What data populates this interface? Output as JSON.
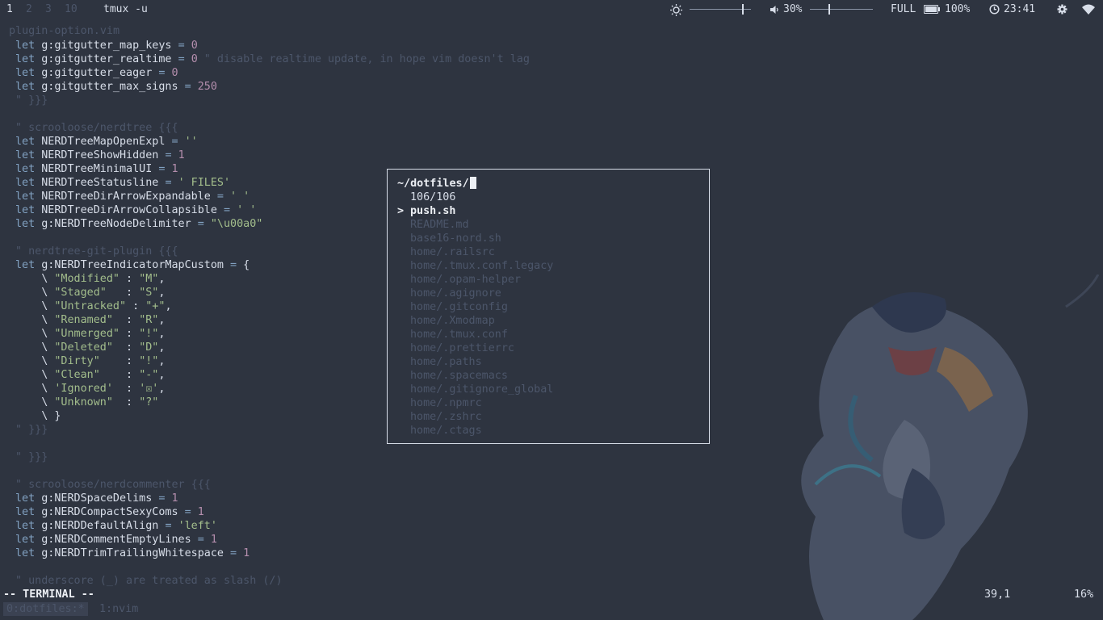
{
  "topbar": {
    "workspaces": [
      "1",
      "2",
      "3",
      "10"
    ],
    "active_workspace": "1",
    "window_title": "tmux -u",
    "brightness_icon": "sun-icon",
    "brightness_level": 0.85,
    "volume_icon": "speaker-icon",
    "volume_label": "30%",
    "volume_level": 0.3,
    "power_state": "FULL",
    "battery_icon": "battery-icon",
    "battery_label": "100%",
    "clock_icon": "clock-icon",
    "time": "23:41",
    "settings_icon": "gear-icon",
    "wifi_icon": "wifi-icon"
  },
  "editor": {
    "file_header": "plugin-option.vim",
    "lines": [
      {
        "parts": [
          [
            "kw",
            "let "
          ],
          [
            "",
            "g:gitgutter_map_keys "
          ],
          [
            "op",
            "= "
          ],
          [
            "num",
            "0"
          ]
        ]
      },
      {
        "parts": [
          [
            "kw",
            "let "
          ],
          [
            "",
            "g:gitgutter_realtime "
          ],
          [
            "op",
            "= "
          ],
          [
            "num",
            "0"
          ],
          [
            "cmt",
            " \" disable realtime update, in hope vim doesn't lag"
          ]
        ]
      },
      {
        "parts": [
          [
            "kw",
            "let "
          ],
          [
            "",
            "g:gitgutter_eager "
          ],
          [
            "op",
            "= "
          ],
          [
            "num",
            "0"
          ]
        ]
      },
      {
        "parts": [
          [
            "kw",
            "let "
          ],
          [
            "",
            "g:gitgutter_max_signs "
          ],
          [
            "op",
            "= "
          ],
          [
            "num",
            "250"
          ]
        ]
      },
      {
        "parts": [
          [
            "cmt",
            "\" }}}"
          ]
        ]
      },
      {
        "parts": []
      },
      {
        "parts": [
          [
            "cmt",
            "\" scrooloose/nerdtree {{{"
          ]
        ]
      },
      {
        "parts": [
          [
            "kw",
            "let "
          ],
          [
            "",
            "NERDTreeMapOpenExpl "
          ],
          [
            "op",
            "= "
          ],
          [
            "str",
            "''"
          ]
        ]
      },
      {
        "parts": [
          [
            "kw",
            "let "
          ],
          [
            "",
            "NERDTreeShowHidden "
          ],
          [
            "op",
            "= "
          ],
          [
            "num",
            "1"
          ]
        ]
      },
      {
        "parts": [
          [
            "kw",
            "let "
          ],
          [
            "",
            "NERDTreeMinimalUI "
          ],
          [
            "op",
            "= "
          ],
          [
            "num",
            "1"
          ]
        ]
      },
      {
        "parts": [
          [
            "kw",
            "let "
          ],
          [
            "",
            "NERDTreeStatusline "
          ],
          [
            "op",
            "= "
          ],
          [
            "str",
            "' FILES'"
          ]
        ]
      },
      {
        "parts": [
          [
            "kw",
            "let "
          ],
          [
            "",
            "NERDTreeDirArrowExpandable "
          ],
          [
            "op",
            "= "
          ],
          [
            "str",
            "' '"
          ]
        ]
      },
      {
        "parts": [
          [
            "kw",
            "let "
          ],
          [
            "",
            "NERDTreeDirArrowCollapsible "
          ],
          [
            "op",
            "= "
          ],
          [
            "str",
            "' '"
          ]
        ]
      },
      {
        "parts": [
          [
            "kw",
            "let "
          ],
          [
            "",
            "g:NERDTreeNodeDelimiter "
          ],
          [
            "op",
            "= "
          ],
          [
            "str",
            "\"\\u00a0\""
          ]
        ]
      },
      {
        "parts": []
      },
      {
        "parts": [
          [
            "cmt",
            "\" nerdtree-git-plugin {{{"
          ]
        ]
      },
      {
        "parts": [
          [
            "kw",
            "let "
          ],
          [
            "",
            "g:NERDTreeIndicatorMapCustom "
          ],
          [
            "op",
            "= "
          ],
          [
            "",
            "{"
          ]
        ]
      },
      {
        "parts": [
          [
            "",
            "    \\ "
          ],
          [
            "str",
            "\"Modified\""
          ],
          [
            "",
            " : "
          ],
          [
            "str",
            "\"M\""
          ],
          [
            "",
            ","
          ]
        ]
      },
      {
        "parts": [
          [
            "",
            "    \\ "
          ],
          [
            "str",
            "\"Staged\"  "
          ],
          [
            "",
            " : "
          ],
          [
            "str",
            "\"S\""
          ],
          [
            "",
            ","
          ]
        ]
      },
      {
        "parts": [
          [
            "",
            "    \\ "
          ],
          [
            "str",
            "\"Untracked\""
          ],
          [
            "",
            " : "
          ],
          [
            "str",
            "\"+\""
          ],
          [
            "",
            ","
          ]
        ]
      },
      {
        "parts": [
          [
            "",
            "    \\ "
          ],
          [
            "str",
            "\"Renamed\" "
          ],
          [
            "",
            " : "
          ],
          [
            "str",
            "\"R\""
          ],
          [
            "",
            ","
          ]
        ]
      },
      {
        "parts": [
          [
            "",
            "    \\ "
          ],
          [
            "str",
            "\"Unmerged\""
          ],
          [
            "",
            " : "
          ],
          [
            "str",
            "\"!\""
          ],
          [
            "",
            ","
          ]
        ]
      },
      {
        "parts": [
          [
            "",
            "    \\ "
          ],
          [
            "str",
            "\"Deleted\" "
          ],
          [
            "",
            " : "
          ],
          [
            "str",
            "\"D\""
          ],
          [
            "",
            ","
          ]
        ]
      },
      {
        "parts": [
          [
            "",
            "    \\ "
          ],
          [
            "str",
            "\"Dirty\"   "
          ],
          [
            "",
            " : "
          ],
          [
            "str",
            "\"!\""
          ],
          [
            "",
            ","
          ]
        ]
      },
      {
        "parts": [
          [
            "",
            "    \\ "
          ],
          [
            "str",
            "\"Clean\"   "
          ],
          [
            "",
            " : "
          ],
          [
            "str",
            "\"-\""
          ],
          [
            "",
            ","
          ]
        ]
      },
      {
        "parts": [
          [
            "",
            "    \\ "
          ],
          [
            "str",
            "'Ignored' "
          ],
          [
            "",
            " : "
          ],
          [
            "str",
            "'☒'"
          ],
          [
            "",
            ","
          ]
        ]
      },
      {
        "parts": [
          [
            "",
            "    \\ "
          ],
          [
            "str",
            "\"Unknown\" "
          ],
          [
            "",
            " : "
          ],
          [
            "str",
            "\"?\""
          ]
        ]
      },
      {
        "parts": [
          [
            "",
            "    \\ }"
          ]
        ]
      },
      {
        "parts": [
          [
            "cmt",
            "\" }}}"
          ]
        ]
      },
      {
        "parts": []
      },
      {
        "parts": [
          [
            "cmt",
            "\" }}}"
          ]
        ]
      },
      {
        "parts": []
      },
      {
        "parts": [
          [
            "cmt",
            "\" scrooloose/nerdcommenter {{{"
          ]
        ]
      },
      {
        "parts": [
          [
            "kw",
            "let "
          ],
          [
            "",
            "g:NERDSpaceDelims "
          ],
          [
            "op",
            "= "
          ],
          [
            "num",
            "1"
          ]
        ]
      },
      {
        "parts": [
          [
            "kw",
            "let "
          ],
          [
            "",
            "g:NERDCompactSexyComs "
          ],
          [
            "op",
            "= "
          ],
          [
            "num",
            "1"
          ]
        ]
      },
      {
        "parts": [
          [
            "kw",
            "let "
          ],
          [
            "",
            "g:NERDDefaultAlign "
          ],
          [
            "op",
            "= "
          ],
          [
            "str",
            "'left'"
          ]
        ]
      },
      {
        "parts": [
          [
            "kw",
            "let "
          ],
          [
            "",
            "g:NERDCommentEmptyLines "
          ],
          [
            "op",
            "= "
          ],
          [
            "num",
            "1"
          ]
        ]
      },
      {
        "parts": [
          [
            "kw",
            "let "
          ],
          [
            "",
            "g:NERDTrimTrailingWhitespace "
          ],
          [
            "op",
            "= "
          ],
          [
            "num",
            "1"
          ]
        ]
      },
      {
        "parts": []
      },
      {
        "parts": [
          [
            "cmt",
            "\" underscore (_) are treated as slash (/)"
          ]
        ]
      }
    ]
  },
  "picker": {
    "query": "~/dotfiles/",
    "count": "106/106",
    "selected_marker": ">",
    "items": [
      "push.sh",
      "README.md",
      "base16-nord.sh",
      "home/.railsrc",
      "home/.tmux.conf.legacy",
      "home/.opam-helper",
      "home/.agignore",
      "home/.gitconfig",
      "home/.Xmodmap",
      "home/.tmux.conf",
      "home/.prettierrc",
      "home/.paths",
      "home/.spacemacs",
      "home/.gitignore_global",
      "home/.npmrc",
      "home/.zshrc",
      "home/.ctags"
    ]
  },
  "statusline": {
    "mode": "-- TERMINAL --",
    "position": "39,1",
    "percent": "16%"
  },
  "tmux": {
    "window0": "0:dotfiles:*",
    "window1": "1:nvim"
  }
}
